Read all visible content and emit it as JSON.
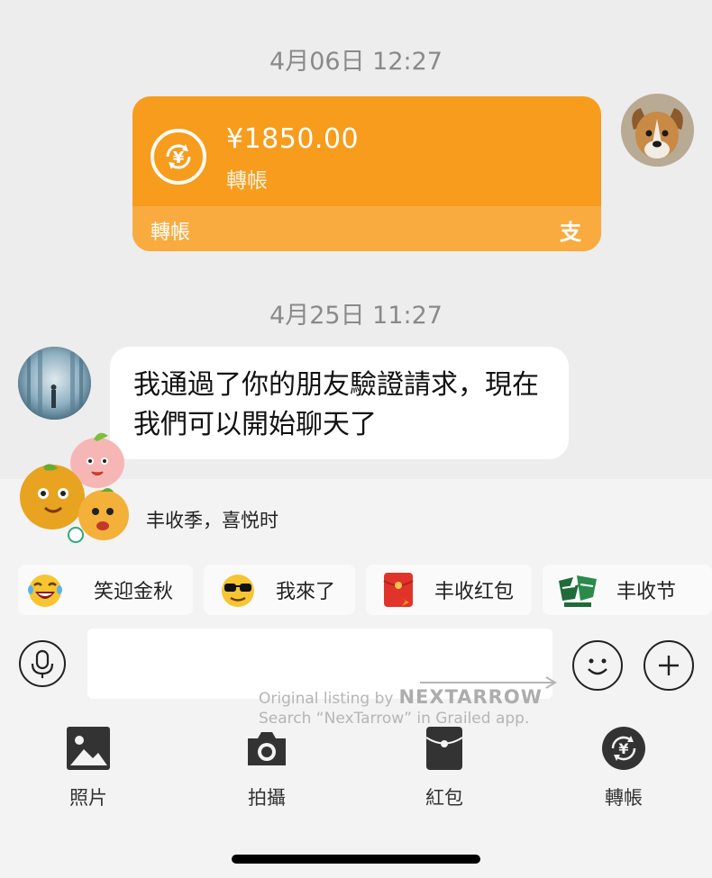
{
  "timestamps": [
    "4月06日 12:27",
    "4月25日 11:27"
  ],
  "transfer": {
    "amount": "¥1850.00",
    "label": "轉帳",
    "footer_label": "轉帳",
    "pay_glyph": "支",
    "coin_symbol": "¥"
  },
  "message": {
    "text": "我通過了你的朋友驗證請求，現在我們可以開始聊天了"
  },
  "promo": {
    "text": "丰收季，喜悦时"
  },
  "quick_chips": [
    {
      "label": "笑迎金秋",
      "icon": "laughing-emoji-icon"
    },
    {
      "label": "我來了",
      "icon": "sunglasses-emoji-icon"
    },
    {
      "label": "丰收红包",
      "icon": "red-packet-icon"
    },
    {
      "label": "丰收节",
      "icon": "yuanqi-sticker-icon"
    }
  ],
  "input": {
    "placeholder": ""
  },
  "watermark": {
    "line1_prefix": "Original listing by",
    "brand": "NEXTARROW",
    "line2": "Search “NexTarrow” in Grailed app."
  },
  "tools": [
    {
      "label": "照片",
      "icon": "photo-icon"
    },
    {
      "label": "拍攝",
      "icon": "camera-icon"
    },
    {
      "label": "紅包",
      "icon": "red-envelope-icon"
    },
    {
      "label": "轉帳",
      "icon": "transfer-icon"
    }
  ],
  "colors": {
    "transfer_orange": "#f79c1c",
    "transfer_orange_light": "#f9ab40",
    "background": "#ededed",
    "bubble": "#ffffff"
  }
}
